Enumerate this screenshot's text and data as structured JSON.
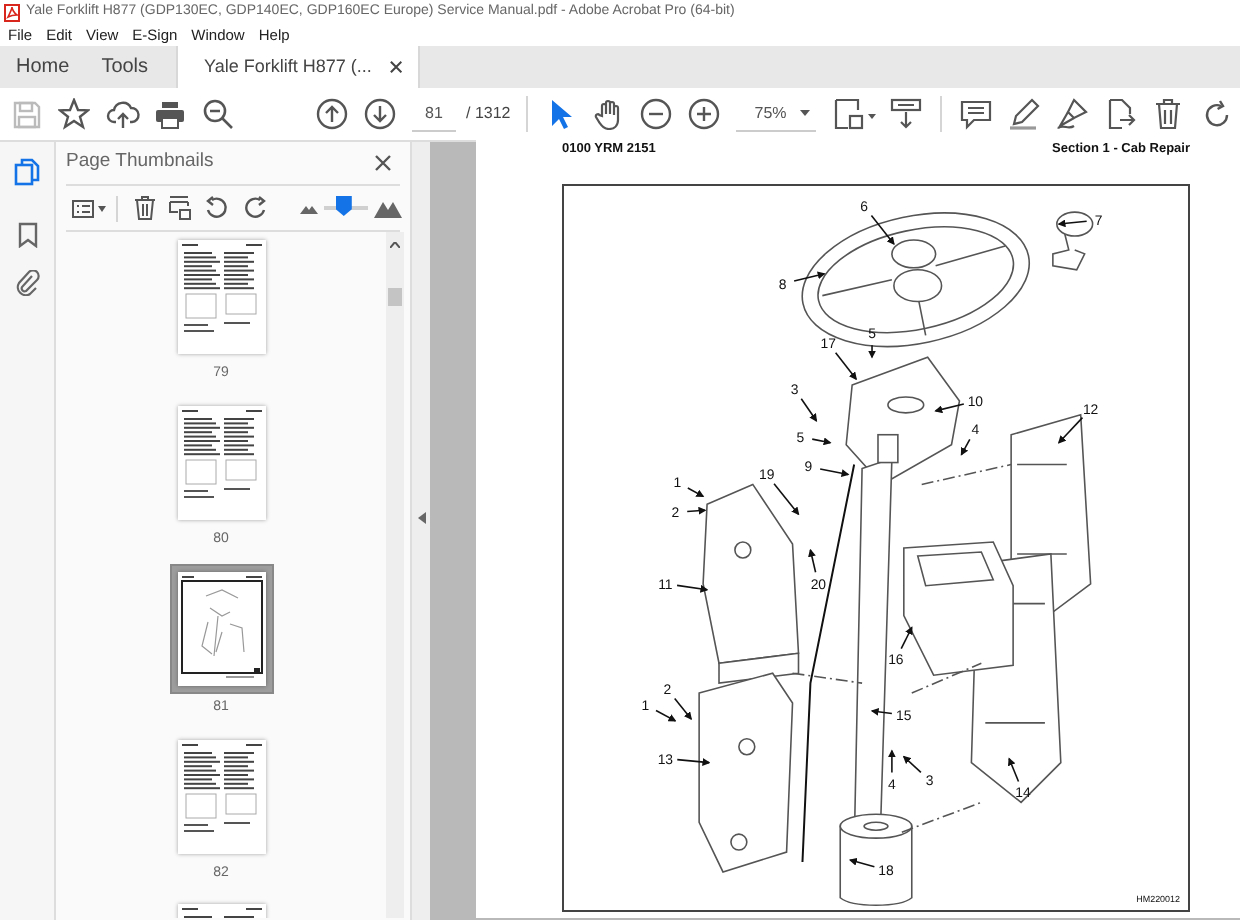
{
  "window": {
    "title": "Yale Forklift H877 (GDP130EC, GDP140EC, GDP160EC Europe) Service Manual.pdf - Adobe Acrobat Pro (64-bit)"
  },
  "menu": [
    "File",
    "Edit",
    "View",
    "E-Sign",
    "Window",
    "Help"
  ],
  "tabs": [
    {
      "label": "Home",
      "selected": false
    },
    {
      "label": "Tools",
      "selected": false
    },
    {
      "label": "Yale Forklift H877 (...",
      "selected": true
    }
  ],
  "toolbar": {
    "page_number": "81",
    "page_total": "/ 1312",
    "zoom": "75%"
  },
  "sidebar": {
    "tabs": [
      {
        "kind": "pages",
        "selected": true
      },
      {
        "kind": "bookmarks",
        "selected": false
      },
      {
        "kind": "attachments",
        "selected": false
      }
    ]
  },
  "thumbnails_panel": {
    "title": "Page Thumbnails",
    "size_slider": {
      "level": 0.45
    },
    "thumbnails": [
      {
        "label": "79",
        "kind": "text",
        "selected": false
      },
      {
        "label": "80",
        "kind": "text",
        "selected": false
      },
      {
        "label": "81",
        "kind": "figure",
        "selected": true
      },
      {
        "label": "82",
        "kind": "text",
        "selected": false
      },
      {
        "kind": "text",
        "selected": false
      }
    ]
  },
  "document": {
    "header_left": "0100 YRM 2151",
    "header_right": "Section 1 - Cab Repair",
    "callouts": [
      {
        "label": "6"
      },
      {
        "label": "7"
      },
      {
        "label": "8"
      },
      {
        "label": "17"
      },
      {
        "label": "5"
      },
      {
        "label": "3"
      },
      {
        "label": "10"
      },
      {
        "label": "12"
      },
      {
        "label": "4"
      },
      {
        "label": "5"
      },
      {
        "label": "9"
      },
      {
        "label": "19"
      },
      {
        "label": "1"
      },
      {
        "label": "2"
      },
      {
        "label": "20"
      },
      {
        "label": "11"
      },
      {
        "label": "16"
      },
      {
        "label": "15"
      },
      {
        "label": "2"
      },
      {
        "label": "1"
      },
      {
        "label": "13"
      },
      {
        "label": "4"
      },
      {
        "label": "3"
      },
      {
        "label": "14"
      },
      {
        "label": "18"
      }
    ],
    "figure_id": "HM220012"
  }
}
